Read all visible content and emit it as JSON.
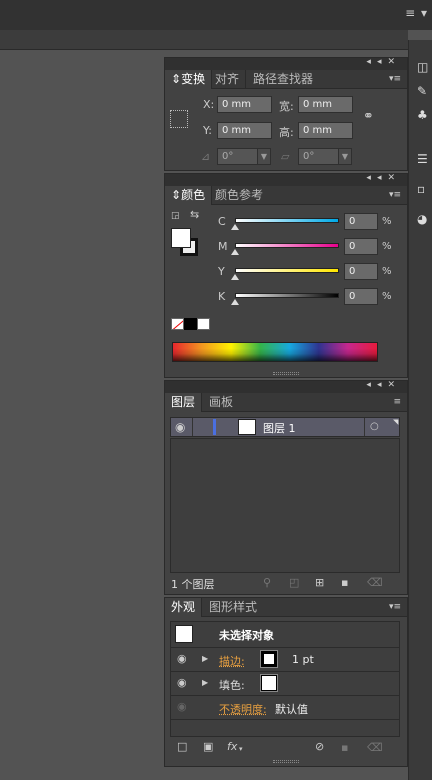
{
  "topbar": {
    "menu_glyph": "≡ ▾"
  },
  "transform": {
    "tabs": [
      "变换",
      "对齐",
      "路径查找器"
    ],
    "x_label": "X:",
    "y_label": "Y:",
    "w_label": "宽:",
    "h_label": "高:",
    "x_value": "0 mm",
    "y_value": "0 mm",
    "w_value": "0 mm",
    "h_value": "0 mm",
    "rotate_value": "0°",
    "shear_value": "0°"
  },
  "color": {
    "tabs": [
      "颜色",
      "颜色参考"
    ],
    "channels": [
      {
        "label": "C",
        "value": "0",
        "unit": "%",
        "from": "#ffffff",
        "to": "#00a9e6"
      },
      {
        "label": "M",
        "value": "0",
        "unit": "%",
        "from": "#ffffff",
        "to": "#e6008c"
      },
      {
        "label": "Y",
        "value": "0",
        "unit": "%",
        "from": "#ffffff",
        "to": "#ffe600"
      },
      {
        "label": "K",
        "value": "0",
        "unit": "%",
        "from": "#ffffff",
        "to": "#000000"
      }
    ]
  },
  "layers": {
    "tabs": [
      "图层",
      "画板"
    ],
    "row_name": "图层 1",
    "count_label": "1 个图层",
    "accent": "#4a6fe0"
  },
  "appearance": {
    "tabs": [
      "外观",
      "图形样式"
    ],
    "header": "未选择对象",
    "stroke_label": "描边:",
    "stroke_value": "1 pt",
    "fill_label": "填色:",
    "opacity_label": "不透明度:",
    "opacity_value": "默认值",
    "fx_label": "fx"
  }
}
